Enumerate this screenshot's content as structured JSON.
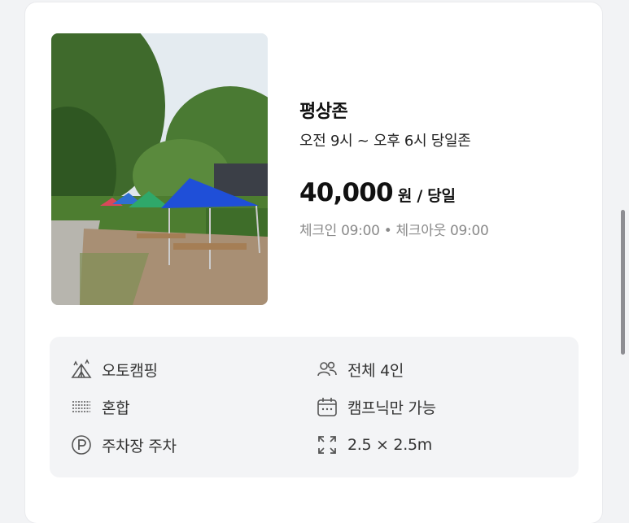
{
  "site": {
    "name": "평상존",
    "hours": "오전 9시 ~ 오후 6시 당일존",
    "price": "40,000",
    "price_unit": "원 / 당일",
    "check_times": "체크인 09:00 • 체크아웃 09:00",
    "photo": "camping-tents-photo"
  },
  "features": [
    {
      "icon": "tent-icon",
      "label": "오토캠핑"
    },
    {
      "icon": "people-icon",
      "label": "전체 4인"
    },
    {
      "icon": "ground-icon",
      "label": "혼합"
    },
    {
      "icon": "calendar-icon",
      "label": "캠프닉만 가능"
    },
    {
      "icon": "parking-icon",
      "label": "주차장 주차"
    },
    {
      "icon": "expand-icon",
      "label": "2.5 × 2.5m"
    }
  ]
}
